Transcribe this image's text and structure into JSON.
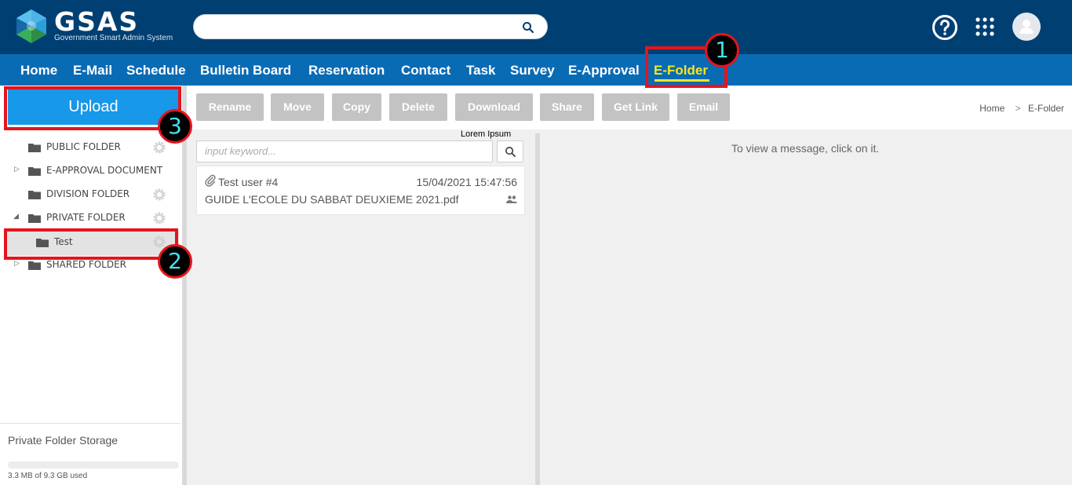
{
  "app": {
    "name": "GSAS",
    "subtitle": "Government Smart Admin System",
    "search_placeholder": ""
  },
  "nav": {
    "items": [
      "Home",
      "E-Mail",
      "Schedule",
      "Bulletin Board",
      "Reservation",
      "Contact",
      "Task",
      "Survey",
      "E-Approval",
      "E-Folder"
    ],
    "active": "E-Folder"
  },
  "annotations": {
    "badge1": "1",
    "badge2": "2",
    "badge3": "3"
  },
  "sidebar": {
    "upload_label": "Upload",
    "folders": [
      {
        "label": "PUBLIC FOLDER",
        "has_arrow": false,
        "gear": true
      },
      {
        "label": "E-APPROVAL DOCUMENT",
        "has_arrow": true,
        "expanded": false,
        "gear": false
      },
      {
        "label": "DIVISION FOLDER",
        "has_arrow": false,
        "gear": true
      },
      {
        "label": "PRIVATE FOLDER",
        "has_arrow": true,
        "expanded": true,
        "gear": true
      },
      {
        "label": "Test",
        "has_arrow": false,
        "gear": true,
        "selected": true
      },
      {
        "label": "SHARED FOLDER",
        "has_arrow": true,
        "expanded": false,
        "gear": false
      }
    ],
    "storage_title": "Private Folder Storage",
    "storage_used": "3.3 MB of 9.3 GB used",
    "storage_fraction": 0.00035
  },
  "toolbar": {
    "buttons": [
      "Rename",
      "Move",
      "Copy",
      "Delete",
      "Download",
      "Share",
      "Get Link",
      "Email"
    ]
  },
  "breadcrumb": {
    "home": "Home",
    "separator": ">",
    "current": "E-Folder"
  },
  "list": {
    "lorem": "Lorem Ipsum",
    "keyword_placeholder": "input keyword...",
    "files": [
      {
        "user": "Test user #4",
        "date": "15/04/2021 15:47:56",
        "name": "GUIDE L'ECOLE DU SABBAT DEUXIEME 2021.pdf"
      }
    ]
  },
  "viewer": {
    "message": "To view a message, click on it."
  },
  "colors": {
    "topbar": "#003f72",
    "navbar": "#0a6bb5",
    "active_nav": "#f7e61c",
    "upload": "#1798e8",
    "annotation": "#e5141c",
    "badge_digit": "#45e0e8"
  }
}
